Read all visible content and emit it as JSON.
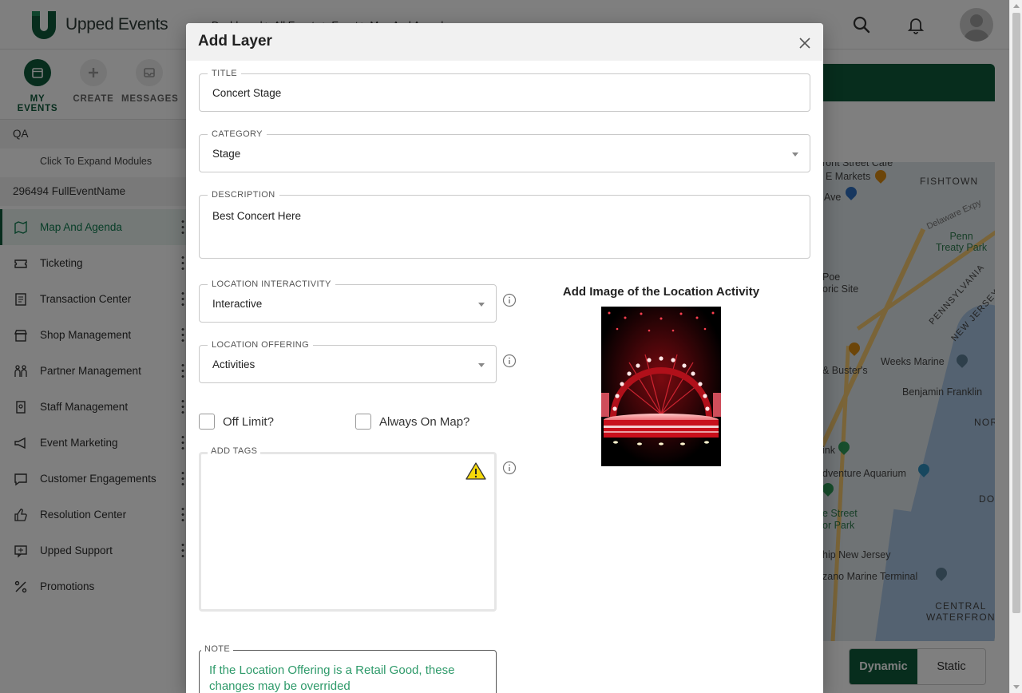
{
  "app": {
    "name": "Upped Events",
    "breadcrumb": "Dashboard > All Events > Event > Map And Agenda"
  },
  "quicknav": [
    {
      "label": "MY EVENTS",
      "icon": "calendar-icon",
      "active": true
    },
    {
      "label": "CREATE",
      "icon": "plus-icon",
      "active": false
    },
    {
      "label": "MESSAGES",
      "icon": "inbox-icon",
      "active": false
    }
  ],
  "sidebar": {
    "org": "QA",
    "expand_hint": "Click To Expand Modules",
    "event": "296494 FullEventName",
    "items": [
      {
        "label": "Map And Agenda",
        "icon": "map-icon",
        "active": true
      },
      {
        "label": "Ticketing",
        "icon": "ticket-icon"
      },
      {
        "label": "Transaction Center",
        "icon": "receipt-icon"
      },
      {
        "label": "Shop Management",
        "icon": "store-icon"
      },
      {
        "label": "Partner Management",
        "icon": "partners-icon"
      },
      {
        "label": "Staff Management",
        "icon": "badge-icon"
      },
      {
        "label": "Event Marketing",
        "icon": "megaphone-icon"
      },
      {
        "label": "Customer Engagements",
        "icon": "chat-icon"
      },
      {
        "label": "Resolution Center",
        "icon": "thumbs-up-icon"
      },
      {
        "label": "Upped Support",
        "icon": "support-icon"
      },
      {
        "label": "Promotions",
        "icon": "percent-icon"
      }
    ]
  },
  "map": {
    "labels": {
      "street_cafe": "ront Street Cafe",
      "markets": "E Markets",
      "ave": "Ave",
      "fishtown": "FISHTOWN",
      "delaware": "Delaware Expy",
      "penn_treaty": "Penn\nTreaty Park",
      "poe": "Poe\noric Site",
      "pennsylvania": "PENNSYLVANIA",
      "new_jersey": "NEW JERSEY",
      "busters": "& Buster's",
      "weeks_marine": "Weeks Marine",
      "benjamin": "Benjamin Franklin",
      "nor": "NOR",
      "ink": "ink",
      "aquarium": "dventure Aquarium",
      "do": "DO",
      "street_park": "e Street\nor Park",
      "ship_nj": "hip New Jersey",
      "marine_terminal": "zano Marine Terminal",
      "central": "CENTRAL\nWATERFRON"
    },
    "modes": [
      "Dynamic",
      "Static"
    ],
    "active_mode": "Dynamic"
  },
  "modal": {
    "title": "Add Layer",
    "fields": {
      "title": {
        "label": "TITLE",
        "value": "Concert Stage"
      },
      "category": {
        "label": "CATEGORY",
        "value": "Stage"
      },
      "description": {
        "label": "DESCRIPTION",
        "value": "Best Concert Here"
      },
      "interactivity": {
        "label": "LOCATION INTERACTIVITY",
        "value": "Interactive"
      },
      "offering": {
        "label": "LOCATION OFFERING",
        "value": "Activities"
      }
    },
    "checkboxes": {
      "off_limit": {
        "label": "Off Limit?",
        "checked": false
      },
      "always_on_map": {
        "label": "Always On Map?",
        "checked": false
      }
    },
    "tags": {
      "label": "ADD TAGS"
    },
    "note": {
      "label": "NOTE",
      "text": "If the Location Offering is a Retail Good, these changes may be overrided"
    },
    "image_section": {
      "title": "Add Image of the Location Activity"
    }
  },
  "colors": {
    "brand": "#0e5a3b",
    "note_text": "#2e9a6a",
    "warning": "#f5d90a"
  }
}
